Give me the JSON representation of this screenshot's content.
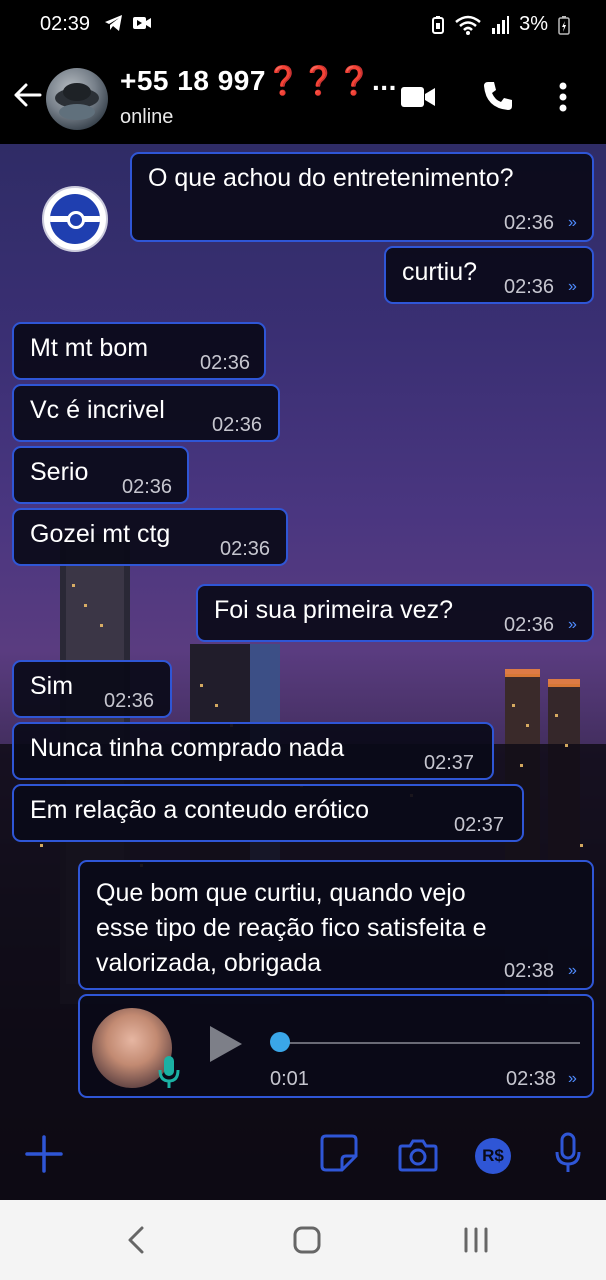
{
  "status_bar": {
    "time": "02:39",
    "battery": "3%"
  },
  "header": {
    "contact_name": "+55 18 997❓❓❓...",
    "status": "online"
  },
  "messages": [
    {
      "text": "O que achou do entretenimento?",
      "time": "02:36",
      "tick": "»"
    },
    {
      "text": "curtiu?",
      "time": "02:36",
      "tick": "»"
    },
    {
      "text": "Mt mt bom",
      "time": "02:36"
    },
    {
      "text": "Vc é incrivel",
      "time": "02:36"
    },
    {
      "text": "Serio",
      "time": "02:36"
    },
    {
      "text": "Gozei mt ctg",
      "time": "02:36"
    },
    {
      "text": "Foi sua primeira vez?",
      "time": "02:36",
      "tick": "»"
    },
    {
      "text": "Sim",
      "time": "02:36"
    },
    {
      "text": "Nunca tinha comprado nada",
      "time": "02:37"
    },
    {
      "text": "Em relação a conteudo erótico",
      "time": "02:37"
    },
    {
      "text_lines": [
        "Que bom que curtiu, quando vejo",
        "esse tipo de reação fico satisfeita e",
        "valorizada, obrigada"
      ],
      "time": "02:38",
      "tick": "»"
    }
  ],
  "audio": {
    "duration": "0:01",
    "time": "02:38",
    "tick": "»",
    "progress": 0.0
  },
  "input_bar": {
    "currency_label": "R$"
  },
  "colors": {
    "accent": "#2f56d6",
    "bubble_bg": "#0a0a18",
    "tick": "#4f8cff",
    "audio_dot": "#3aa6e8",
    "mic_green": "#1bb1a3"
  }
}
